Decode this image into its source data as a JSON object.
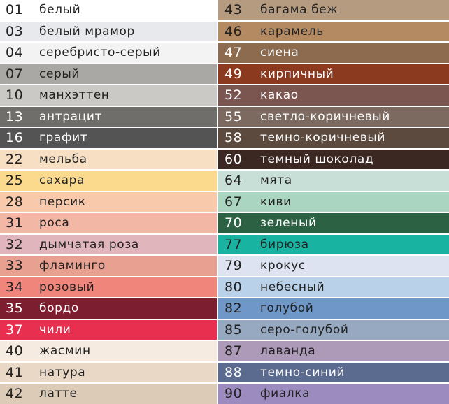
{
  "swatches": {
    "left": [
      {
        "code": "01",
        "name": "белый",
        "bg": "#ffffff",
        "fg": "#222222"
      },
      {
        "code": "03",
        "name": "белый мрамор",
        "bg": "#e8e9ec",
        "fg": "#222222"
      },
      {
        "code": "04",
        "name": "серебристо-серый",
        "bg": "#f3f3f3",
        "fg": "#222222"
      },
      {
        "code": "07",
        "name": "серый",
        "bg": "#a9a8a4",
        "fg": "#222222"
      },
      {
        "code": "10",
        "name": "манхэттен",
        "bg": "#cbc9c5",
        "fg": "#222222"
      },
      {
        "code": "13",
        "name": "антрацит",
        "bg": "#6f6e6b",
        "fg": "#ffffff"
      },
      {
        "code": "16",
        "name": "графит",
        "bg": "#555454",
        "fg": "#ffffff"
      },
      {
        "code": "22",
        "name": "мельба",
        "bg": "#f6dfc2",
        "fg": "#222222"
      },
      {
        "code": "25",
        "name": "сахара",
        "bg": "#fbd98d",
        "fg": "#222222"
      },
      {
        "code": "28",
        "name": "персик",
        "bg": "#f9c9ab",
        "fg": "#222222"
      },
      {
        "code": "31",
        "name": "роса",
        "bg": "#f3b7a6",
        "fg": "#222222"
      },
      {
        "code": "32",
        "name": "дымчатая роза",
        "bg": "#e1b5bc",
        "fg": "#222222"
      },
      {
        "code": "33",
        "name": "фламинго",
        "bg": "#e8a191",
        "fg": "#222222"
      },
      {
        "code": "34",
        "name": "розовый",
        "bg": "#ef857b",
        "fg": "#222222"
      },
      {
        "code": "35",
        "name": "бордо",
        "bg": "#7c1d30",
        "fg": "#ffffff"
      },
      {
        "code": "37",
        "name": "чили",
        "bg": "#e82f4f",
        "fg": "#ffffff"
      },
      {
        "code": "40",
        "name": "жасмин",
        "bg": "#f5ebe0",
        "fg": "#222222"
      },
      {
        "code": "41",
        "name": "натура",
        "bg": "#ead8c6",
        "fg": "#222222"
      },
      {
        "code": "42",
        "name": "латте",
        "bg": "#dccbb6",
        "fg": "#222222"
      }
    ],
    "right": [
      {
        "code": "43",
        "name": "багама беж",
        "bg": "#b59b80",
        "fg": "#222222"
      },
      {
        "code": "46",
        "name": "карамель",
        "bg": "#b48a62",
        "fg": "#222222"
      },
      {
        "code": "47",
        "name": "сиена",
        "bg": "#8d6b4f",
        "fg": "#ffffff"
      },
      {
        "code": "49",
        "name": "кирпичный",
        "bg": "#8b3a1f",
        "fg": "#ffffff"
      },
      {
        "code": "52",
        "name": "какао",
        "bg": "#7b5550",
        "fg": "#ffffff"
      },
      {
        "code": "55",
        "name": "светло-коричневый",
        "bg": "#7c6a60",
        "fg": "#ffffff"
      },
      {
        "code": "58",
        "name": "темно-коричневый",
        "bg": "#5d4a3f",
        "fg": "#ffffff"
      },
      {
        "code": "60",
        "name": "темный шоколад",
        "bg": "#3b2822",
        "fg": "#ffffff"
      },
      {
        "code": "64",
        "name": "мята",
        "bg": "#c8dfd7",
        "fg": "#222222"
      },
      {
        "code": "67",
        "name": "киви",
        "bg": "#a9d5c1",
        "fg": "#222222"
      },
      {
        "code": "70",
        "name": "зеленый",
        "bg": "#2d6143",
        "fg": "#ffffff"
      },
      {
        "code": "77",
        "name": "бирюза",
        "bg": "#19b3a2",
        "fg": "#222222"
      },
      {
        "code": "79",
        "name": "крокус",
        "bg": "#dde3f1",
        "fg": "#222222"
      },
      {
        "code": "80",
        "name": "небесный",
        "bg": "#b9d1e9",
        "fg": "#222222"
      },
      {
        "code": "82",
        "name": "голубой",
        "bg": "#6f97c8",
        "fg": "#222222"
      },
      {
        "code": "85",
        "name": "серо-голубой",
        "bg": "#96a9c0",
        "fg": "#222222"
      },
      {
        "code": "87",
        "name": "лаванда",
        "bg": "#ad9ab8",
        "fg": "#222222"
      },
      {
        "code": "88",
        "name": "темно-синий",
        "bg": "#5a6b8f",
        "fg": "#ffffff"
      },
      {
        "code": "90",
        "name": "фиалка",
        "bg": "#9b8bbf",
        "fg": "#222222"
      }
    ]
  }
}
